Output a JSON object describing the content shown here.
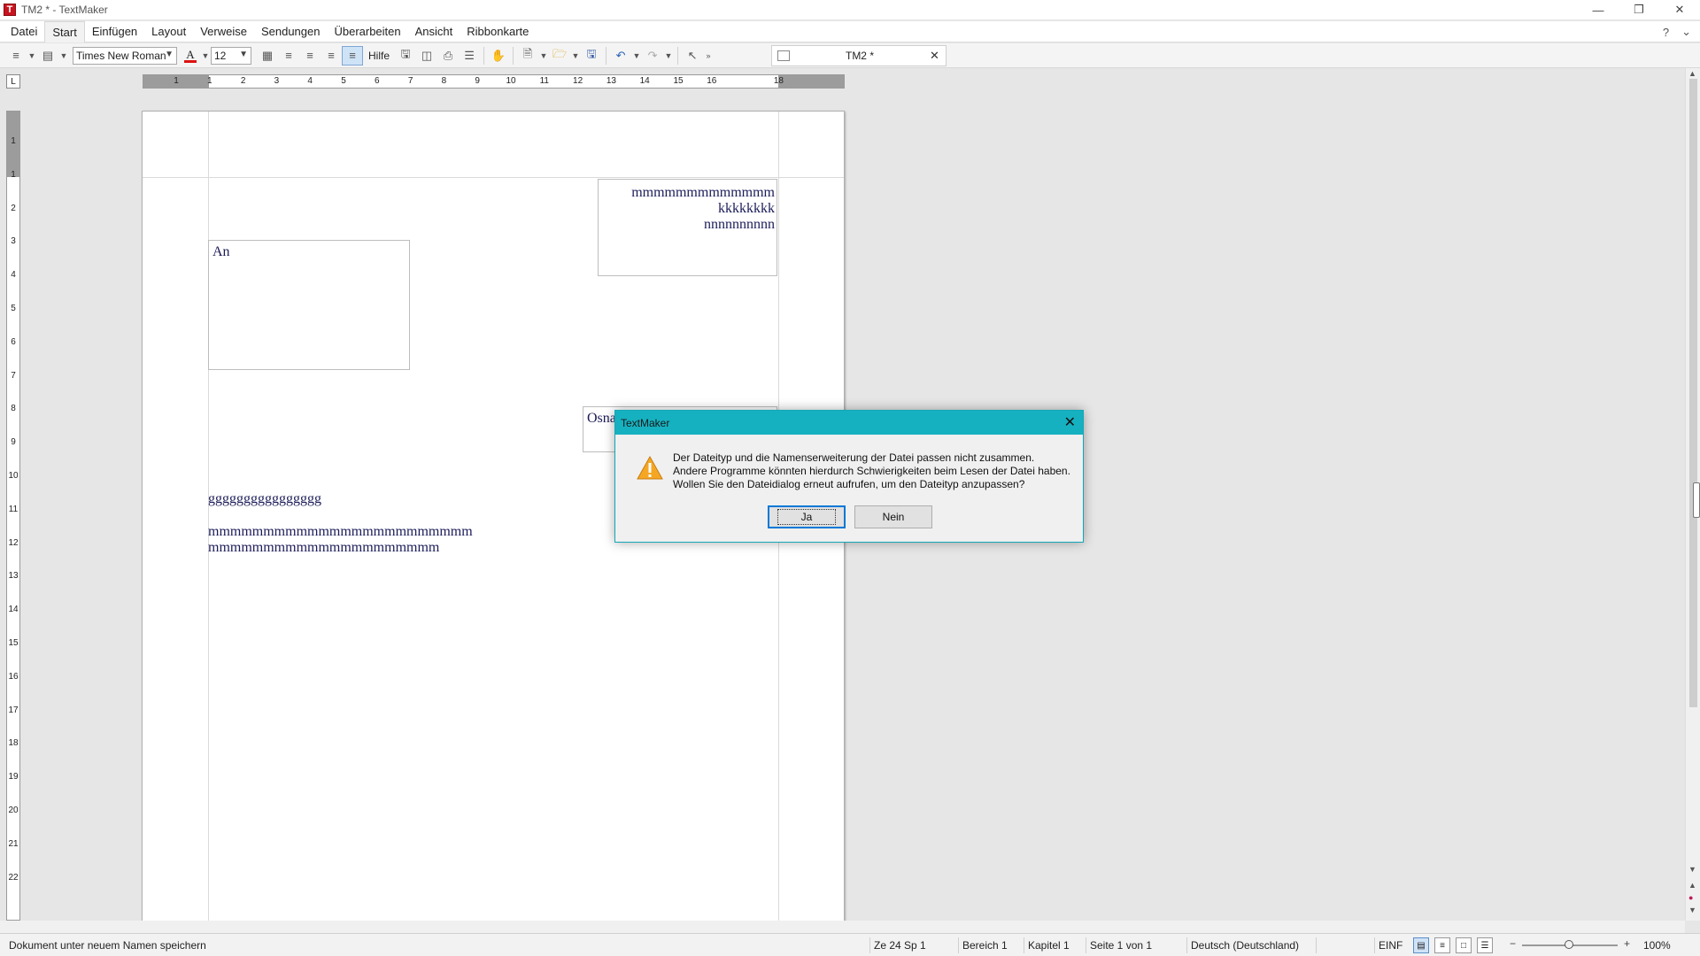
{
  "window": {
    "title": "TM2 * - TextMaker",
    "app_icon_letter": "T"
  },
  "menu": {
    "items": [
      "Datei",
      "Start",
      "Einfügen",
      "Layout",
      "Verweise",
      "Sendungen",
      "Überarbeiten",
      "Ansicht",
      "Ribbonkarte"
    ],
    "active": "Start",
    "help": "?"
  },
  "toolbar": {
    "font_name": "Times New Roman",
    "font_size": "12",
    "font_color_letter": "A",
    "font_color": "#dd1111",
    "help_label": "Hilfe",
    "doc_tab_label": "TM2 *"
  },
  "ruler": {
    "h_numbers": [
      "1",
      "1",
      "2",
      "3",
      "4",
      "5",
      "6",
      "7",
      "8",
      "9",
      "10",
      "11",
      "12",
      "13",
      "14",
      "15",
      "16",
      "18"
    ],
    "v_numbers": [
      "1",
      "1",
      "2",
      "3",
      "4",
      "5",
      "6",
      "7",
      "8",
      "9",
      "10",
      "11",
      "12",
      "13",
      "14",
      "15",
      "16",
      "17",
      "18",
      "19",
      "20",
      "21",
      "22"
    ]
  },
  "document": {
    "header_right": [
      "mmmmmmmmmmmmm",
      "kkkkkkkk",
      "nnnnnnnnnn"
    ],
    "address_frame": "An",
    "sender_frame": "Osna",
    "body_line1": "gggggggggggggggg",
    "body_line2": "mmmmmmmmmmmmmmmmmmmmmmmm",
    "body_line3": "mmmmmmmmmmmmmmmmmmmmm"
  },
  "dialog": {
    "title": "TextMaker",
    "message_lines": [
      "Der Dateityp und die Namenserweiterung der Datei passen nicht zusammen.",
      "Andere Programme könnten hierdurch Schwierigkeiten beim Lesen der Datei haben.",
      "Wollen Sie den Dateidialog erneut aufrufen, um den Dateityp anzupassen?"
    ],
    "yes_label": "Ja",
    "no_label": "Nein",
    "title_color": "#16b1c0",
    "warning_color": "#f5a623"
  },
  "status": {
    "message": "Dokument unter neuem Namen speichern",
    "position": "Ze 24 Sp 1",
    "section": "Bereich 1",
    "chapter": "Kapitel 1",
    "page": "Seite 1 von 1",
    "language": "Deutsch (Deutschland)",
    "mode": "EINF",
    "zoom": "100%"
  }
}
